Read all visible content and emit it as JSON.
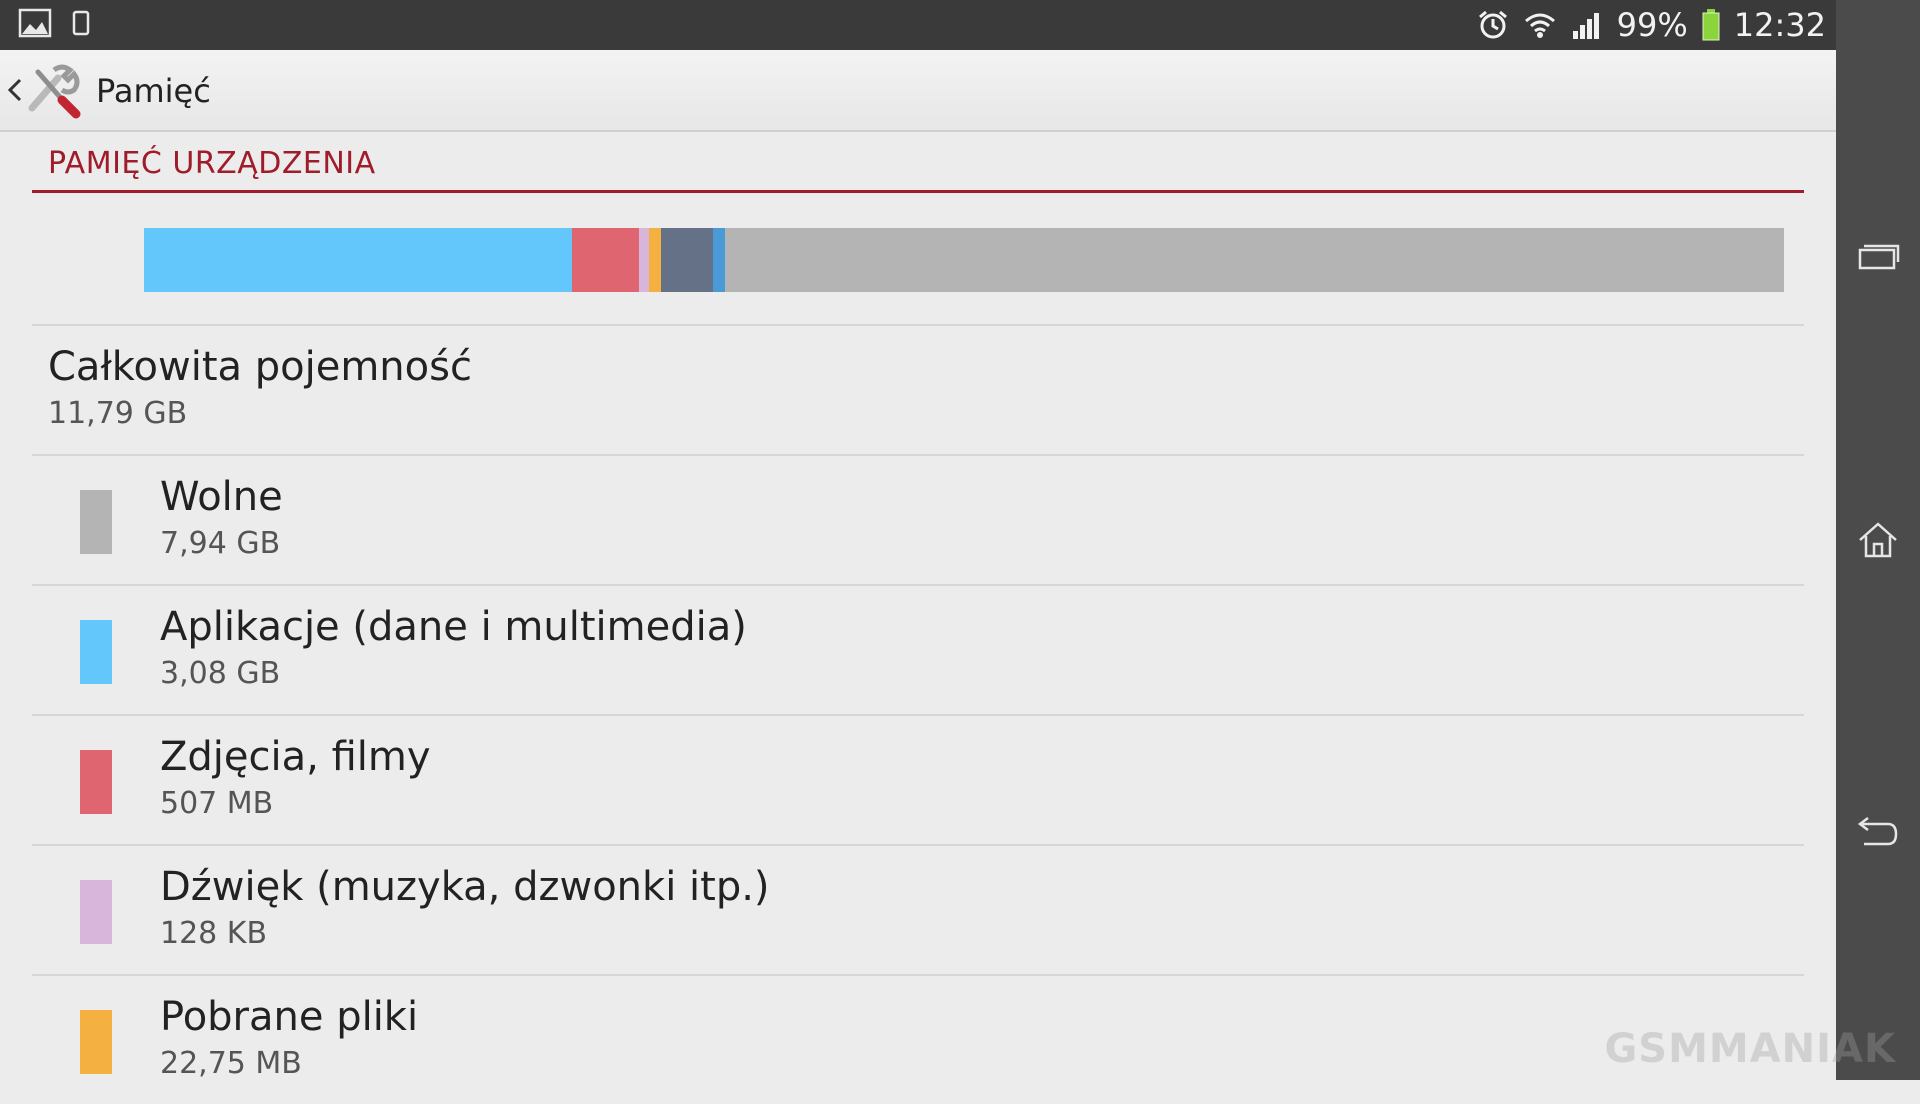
{
  "status_bar": {
    "battery": "99%",
    "time": "12:32",
    "left_icons": [
      "gallery-notification-icon",
      "device-notification-icon"
    ],
    "right_icons": [
      "alarm-icon",
      "wifi-icon",
      "signal-icon",
      "battery-icon"
    ]
  },
  "action_bar": {
    "title": "Pamięć",
    "app_icon": "tools-icon"
  },
  "section": {
    "header": "PAMIĘĆ URZĄDZENIA"
  },
  "usage_bar": {
    "segments": [
      {
        "name": "apps",
        "fraction": 0.261,
        "color": "#63c7fb"
      },
      {
        "name": "photos",
        "fraction": 0.041,
        "color": "#df6670"
      },
      {
        "name": "audio",
        "fraction": 0.006,
        "color": "#d8b6dc"
      },
      {
        "name": "downloads",
        "fraction": 0.007,
        "color": "#f5b042"
      },
      {
        "name": "misc",
        "fraction": 0.032,
        "color": "#647186"
      },
      {
        "name": "other",
        "fraction": 0.007,
        "color": "#4a9ad8"
      },
      {
        "name": "free",
        "fraction": 0.646,
        "color": "#b4b4b4"
      }
    ]
  },
  "total": {
    "label": "Całkowita pojemność",
    "value": "11,79 GB"
  },
  "items": [
    {
      "label": "Wolne",
      "value": "7,94 GB",
      "color": "#b4b4b4"
    },
    {
      "label": "Aplikacje (dane i multimedia)",
      "value": "3,08 GB",
      "color": "#63c7fb"
    },
    {
      "label": "Zdjęcia, filmy",
      "value": "507 MB",
      "color": "#df6670"
    },
    {
      "label": "Dźwięk (muzyka, dzwonki itp.)",
      "value": "128 KB",
      "color": "#d8b6dc"
    },
    {
      "label": "Pobrane pliki",
      "value": "22,75 MB",
      "color": "#f5b042"
    }
  ],
  "navigation": [
    "recent-apps-icon",
    "home-icon",
    "back-icon"
  ],
  "watermark": "GSMMANIAK"
}
